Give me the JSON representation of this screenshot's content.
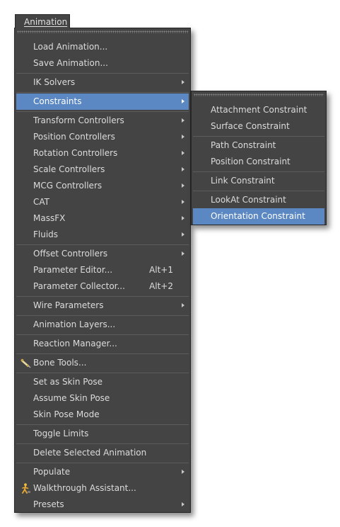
{
  "menu_bar": {
    "title": "Animation"
  },
  "main_menu": {
    "load_animation": "Load Animation...",
    "save_animation": "Save Animation...",
    "ik_solvers": "IK Solvers",
    "constraints": "Constraints",
    "transform_controllers": "Transform Controllers",
    "position_controllers": "Position Controllers",
    "rotation_controllers": "Rotation Controllers",
    "scale_controllers": "Scale Controllers",
    "mcg_controllers": "MCG Controllers",
    "cat": "CAT",
    "massfx": "MassFX",
    "fluids": "Fluids",
    "offset_controllers": "Offset Controllers",
    "parameter_editor": "Parameter Editor...",
    "parameter_editor_shortcut": "Alt+1",
    "parameter_collector": "Parameter Collector...",
    "parameter_collector_shortcut": "Alt+2",
    "wire_parameters": "Wire Parameters",
    "animation_layers": "Animation Layers...",
    "reaction_manager": "Reaction Manager...",
    "bone_tools": "Bone Tools...",
    "set_as_skin_pose": "Set as Skin Pose",
    "assume_skin_pose": "Assume Skin Pose",
    "skin_pose_mode": "Skin Pose Mode",
    "toggle_limits": "Toggle Limits",
    "delete_selected_animation": "Delete Selected Animation",
    "populate": "Populate",
    "walkthrough_assistant": "Walkthrough Assistant...",
    "presets": "Presets"
  },
  "constraints_submenu": {
    "attachment": "Attachment Constraint",
    "surface": "Surface Constraint",
    "path": "Path Constraint",
    "position": "Position Constraint",
    "link": "Link Constraint",
    "lookat": "LookAt Constraint",
    "orientation": "Orientation Constraint"
  },
  "icons": {
    "bone_tools": "bone-tools-icon",
    "walkthrough": "walkthrough-figure-icon",
    "submenu": "chevron-right-icon"
  },
  "colors": {
    "menu_bg": "#444444",
    "highlight": "#5b88c2",
    "text": "#dcdcdc"
  }
}
